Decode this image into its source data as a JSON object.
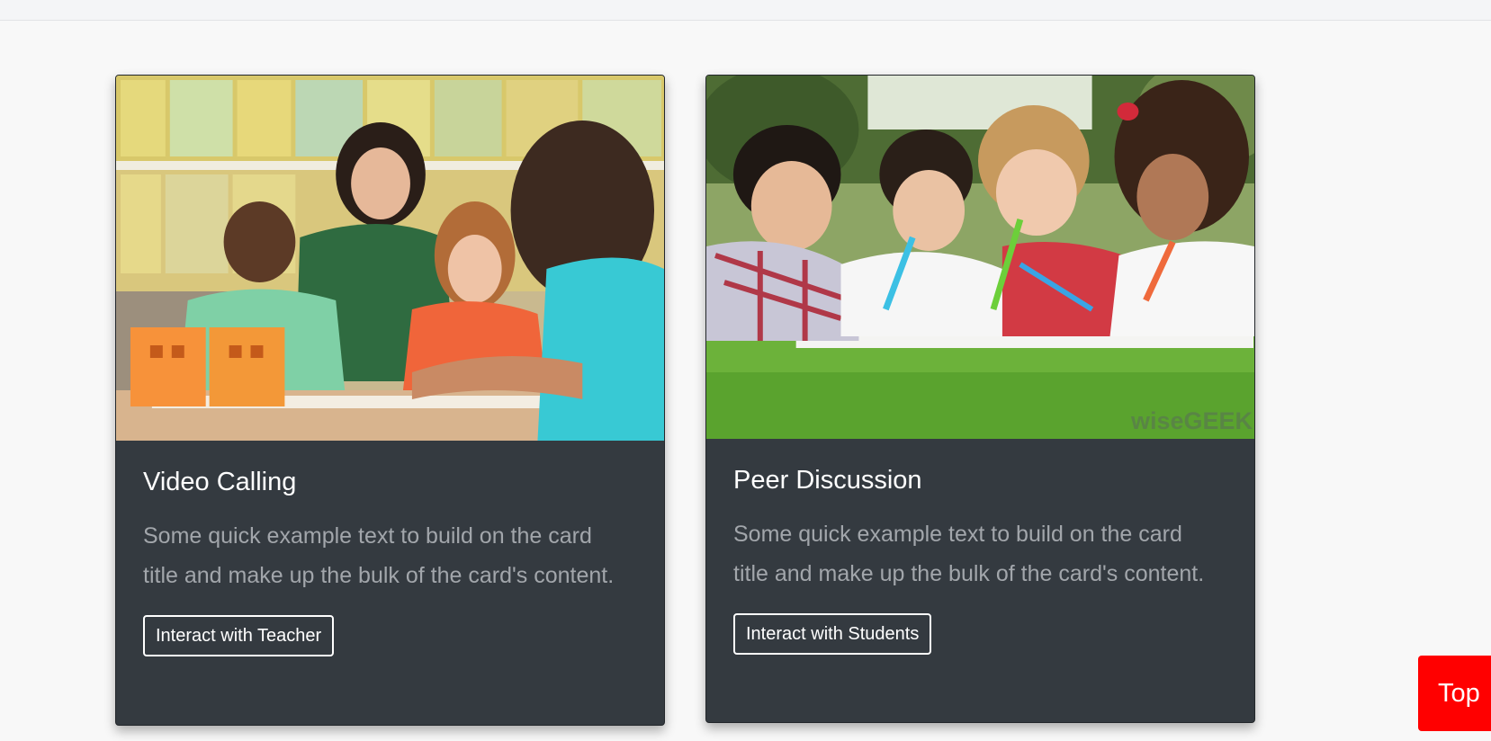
{
  "cards": [
    {
      "image_alt": "Teacher with children drawing at classroom table",
      "title": "Video Calling",
      "text": "Some quick example text to build on the card title and make up the bulk of the card's content.",
      "button_label": "Interact with Teacher"
    },
    {
      "image_alt": "Children drawing on grass outdoors",
      "title": "Peer Discussion",
      "text": "Some quick example text to build on the card title and make up the bulk of the card's content.",
      "button_label": "Interact with Students",
      "image_watermark": "wiseGEEK"
    }
  ],
  "scroll_top_button": {
    "label": "Top"
  },
  "colors": {
    "page_background": "#f8f8f8",
    "card_background": "#343a40",
    "card_text": "#a2a6ab",
    "top_button": "#ff0000"
  }
}
